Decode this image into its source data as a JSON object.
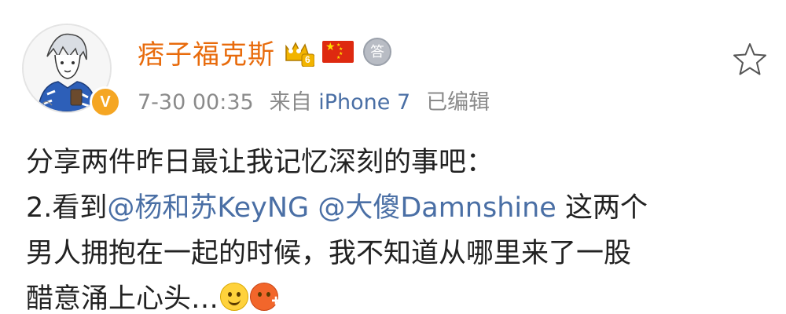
{
  "post": {
    "author": {
      "name": "痞子福克斯",
      "verified_badge": "V",
      "crown_level": "6",
      "answer_badge": "答"
    },
    "meta": {
      "time": "7-30 00:35",
      "source_prefix": "来自",
      "source": "iPhone 7",
      "edited": "已编辑"
    },
    "content": {
      "line1": "分享两件昨日最让我记忆深刻的事吧：",
      "line2_prefix": "2.看到",
      "mention1": "@杨和苏KeyNG",
      "mention2": "@大傻Damnshine",
      "line2_suffix": " 这两个",
      "line3": "男人拥抱在一起的时候，我不知道从哪里来了一股",
      "line4": "醋意涌上心头…"
    },
    "icons": {
      "crown": "crown-icon",
      "flag": "china-flag-icon",
      "answer": "answer-badge-icon",
      "favorite": "star-outline-icon",
      "emoji1": "smile-emoji",
      "emoji2": "angry-emoji"
    },
    "colors": {
      "username": "#e86b0c",
      "link": "#4a6fa5",
      "meta": "#8a8a8a",
      "text": "#222222"
    }
  }
}
